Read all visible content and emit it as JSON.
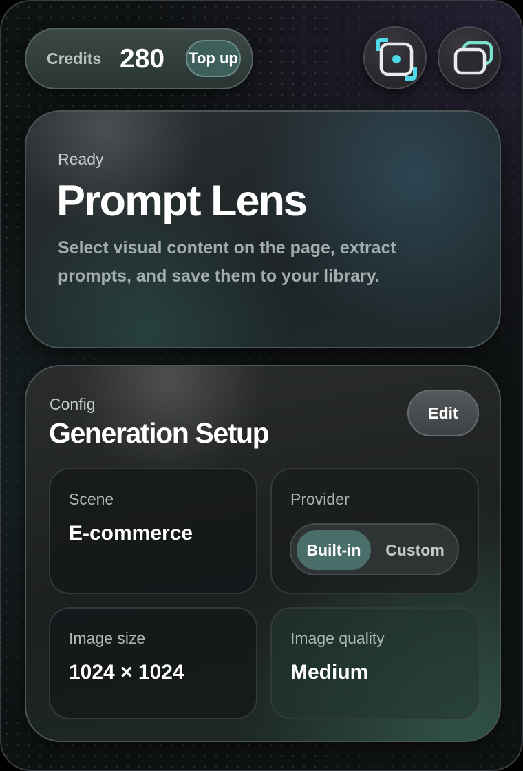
{
  "header": {
    "credits_label": "Credits",
    "credits_value": "280",
    "topup_label": "Top up",
    "capture_icon": "capture-select-icon",
    "windows_icon": "overlapping-windows-icon"
  },
  "lens": {
    "status": "Ready",
    "title": "Prompt Lens",
    "description": "Select visual content on the page, extract prompts, and save them to your library."
  },
  "setup": {
    "label": "Config",
    "title": "Generation Setup",
    "edit_label": "Edit",
    "scene": {
      "label": "Scene",
      "value": "E-commerce"
    },
    "provider": {
      "label": "Provider",
      "options": [
        "Built-in",
        "Custom"
      ],
      "selected": "Built-in"
    },
    "image_size": {
      "label": "Image size",
      "value": "1024 × 1024"
    },
    "image_quality": {
      "label": "Image quality",
      "value": "Medium"
    }
  },
  "colors": {
    "accent": "#4fd8e8",
    "accent_mint": "#7be0cc",
    "segment_active": "#4a6e6a"
  }
}
